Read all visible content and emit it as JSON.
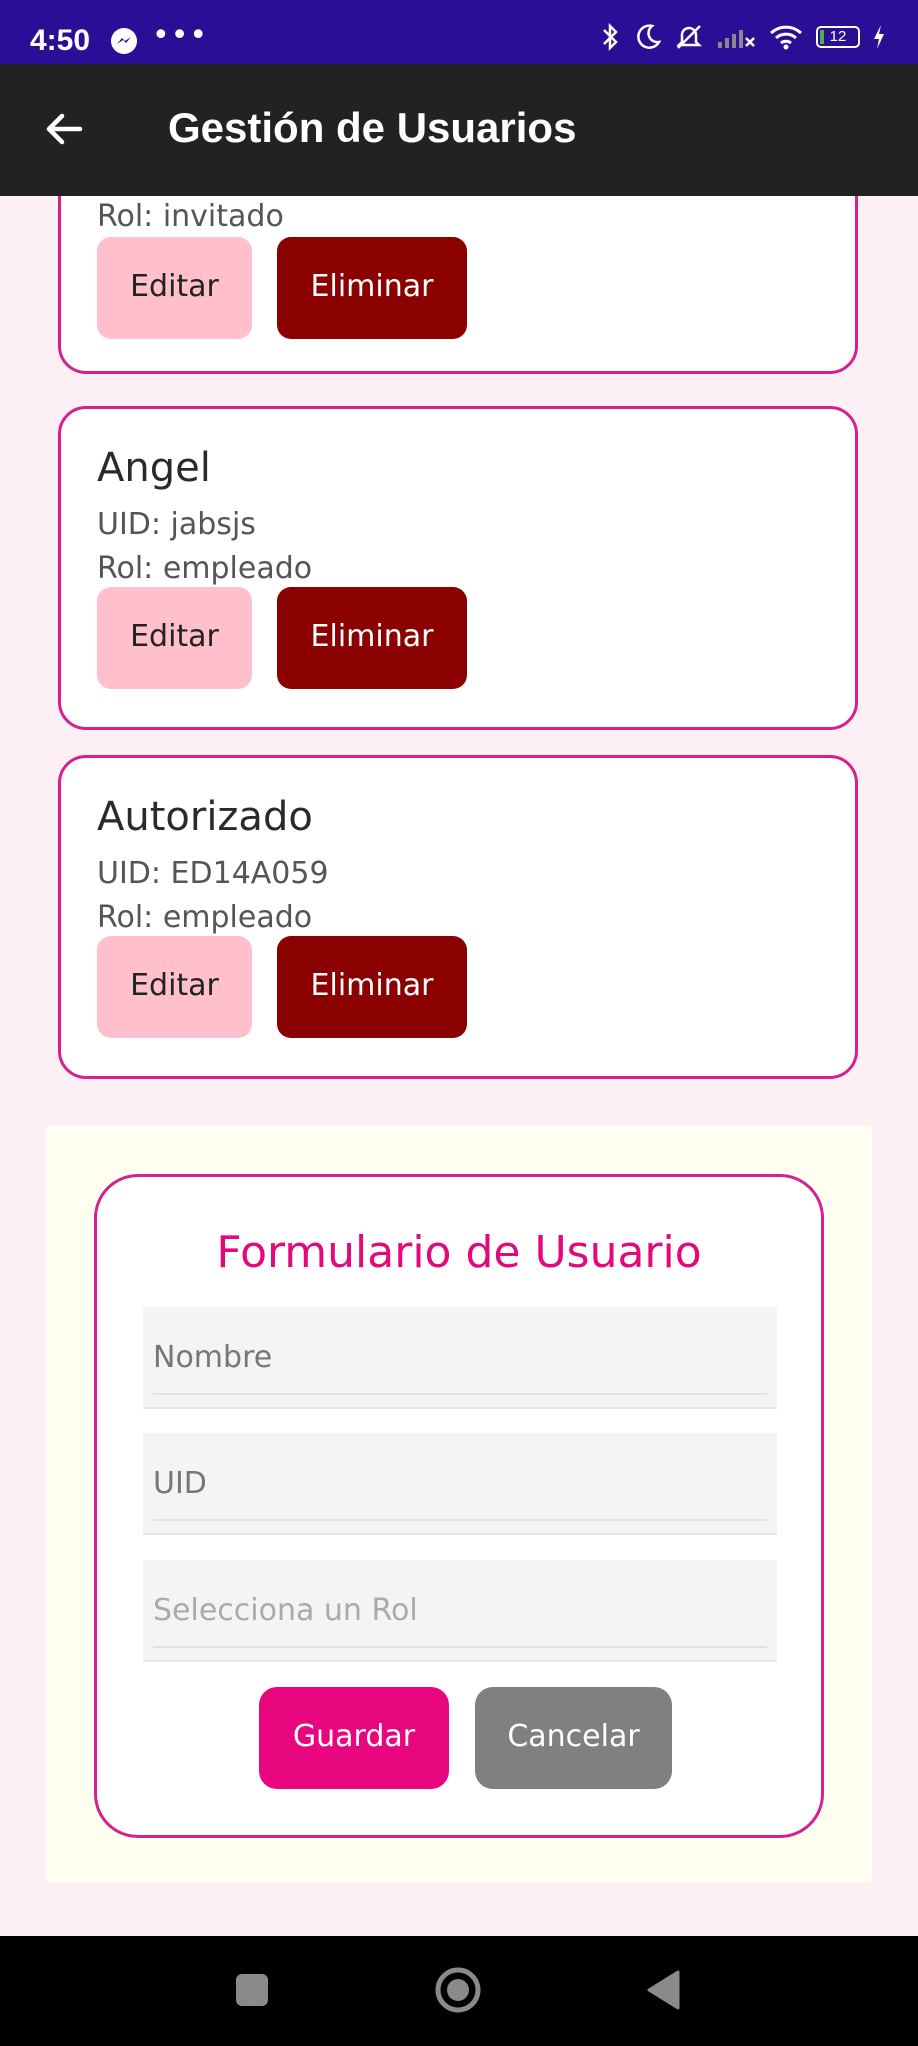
{
  "status_bar": {
    "time": "4:50",
    "battery": "12"
  },
  "app_bar": {
    "title": "Gestión de Usuarios"
  },
  "users": [
    {
      "name": "",
      "uid": "",
      "role": "Rol: invitado",
      "edit_label": "Editar",
      "delete_label": "Eliminar"
    },
    {
      "name": "Angel",
      "uid": "UID: jabsjs",
      "role": "Rol: empleado",
      "edit_label": "Editar",
      "delete_label": "Eliminar"
    },
    {
      "name": "Autorizado",
      "uid": "UID: ED14A059",
      "role": "Rol: empleado",
      "edit_label": "Editar",
      "delete_label": "Eliminar"
    }
  ],
  "form": {
    "title": "Formulario de Usuario",
    "name_placeholder": "Nombre",
    "uid_placeholder": "UID",
    "role_placeholder": "Selecciona un Rol",
    "save_label": "Guardar",
    "cancel_label": "Cancelar"
  },
  "colors": {
    "accent": "#e8067e",
    "card_border": "#d6208f",
    "edit_button": "#ffc0cc",
    "delete_button": "#8b0000",
    "status_bar": "#2a0f96",
    "app_bar": "#222222"
  },
  "icons": {
    "back": "arrow-left-icon",
    "messenger": "messenger-icon",
    "bluetooth": "bluetooth-icon",
    "dnd": "moon-icon",
    "mute": "bell-off-icon",
    "signal": "signal-icon",
    "wifi": "wifi-icon"
  }
}
